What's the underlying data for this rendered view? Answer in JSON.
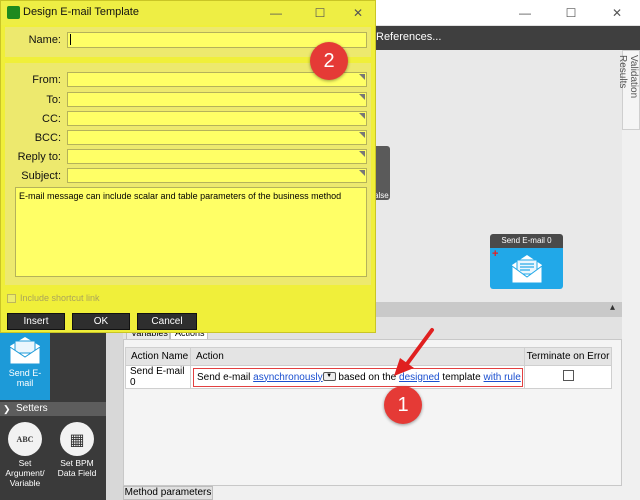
{
  "dialog": {
    "title": "Design E-mail Template",
    "name_label": "Name:",
    "name_value": "",
    "fields": [
      {
        "label": "From:",
        "value": ""
      },
      {
        "label": "To:",
        "value": ""
      },
      {
        "label": "CC:",
        "value": ""
      },
      {
        "label": "BCC:",
        "value": ""
      },
      {
        "label": "Reply to:",
        "value": ""
      },
      {
        "label": "Subject:",
        "value": ""
      }
    ],
    "body_text": "E-mail message can include scalar and table parameters of the business method",
    "shortcut_label": "Include shortcut link",
    "buttons": {
      "insert": "Insert",
      "ok": "OK",
      "cancel": "Cancel"
    },
    "window_buttons": {
      "minimize": "—",
      "maximize": "☐",
      "close": "✕"
    }
  },
  "app": {
    "window_buttons": {
      "minimize": "—",
      "maximize": "☐",
      "close": "✕"
    },
    "toolbar_item": "References...",
    "validation_tab": "Validation Results",
    "partial_node_text": "alse",
    "send_node_title": "Send E-mail 0"
  },
  "panel": {
    "tabs": [
      "Variables",
      "Actions"
    ],
    "columns": {
      "action_name": "Action Name",
      "action": "Action",
      "terminate": "Terminate on Error"
    },
    "row": {
      "name": "Send E-mail 0",
      "text1": "Send e-mail",
      "link_async": "asynchronously",
      "text2": "based on the",
      "link_designed": "designed",
      "text3": "template",
      "link_rule": "with rule"
    },
    "method_params_tab": "Method parameters"
  },
  "toolbox": {
    "send_email_label": "Send E-mail",
    "setters_header": "Setters",
    "tools": [
      {
        "label": "Set Argument/ Variable",
        "icon_text": "ABC"
      },
      {
        "label": "Set BPM Data Field",
        "icon_text": "▦"
      }
    ]
  },
  "badges": {
    "one": "1",
    "two": "2"
  },
  "colors": {
    "dialog_bg": "#f0ef3a",
    "accent_blue": "#21a8e8",
    "badge_red": "#e53a36"
  }
}
